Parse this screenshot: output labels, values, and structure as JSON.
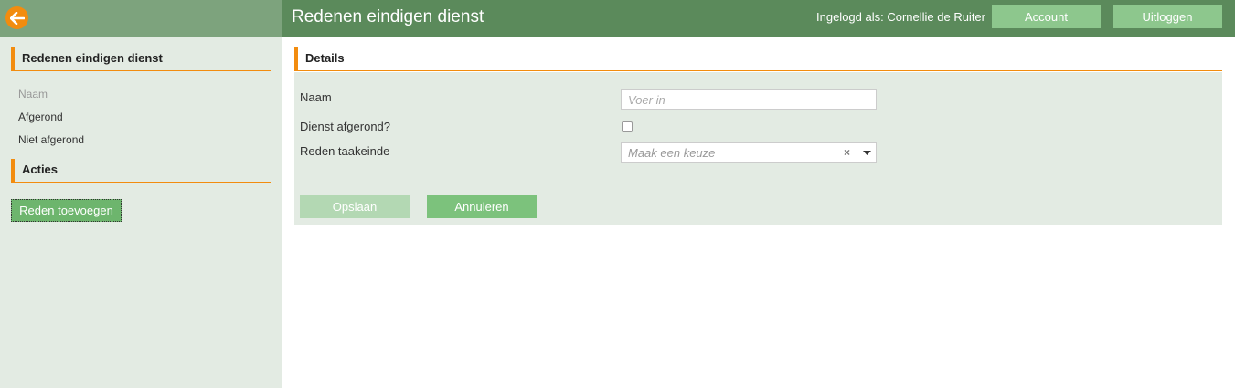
{
  "header": {
    "title": "Redenen eindigen dienst",
    "user_label": "Ingelogd als: Cornellie de Ruiter",
    "account_label": "Account",
    "logout_label": "Uitloggen",
    "back_icon": "arrow-left-icon"
  },
  "sidebar": {
    "section_title": "Redenen eindigen dienst",
    "filters": [
      {
        "label": "Naam"
      },
      {
        "label": "Afgerond"
      },
      {
        "label": "Niet afgerond"
      }
    ],
    "actions_title": "Acties",
    "add_button_label": "Reden toevoegen"
  },
  "details": {
    "title": "Details",
    "name_label": "Naam",
    "name_placeholder": "Voer in",
    "completed_label": "Dienst afgerond?",
    "completed_checked": false,
    "reason_label": "Reden taakeinde",
    "reason_placeholder": "Maak een keuze",
    "save_label": "Opslaan",
    "cancel_label": "Annuleren"
  },
  "colors": {
    "header_green": "#5b8a5b",
    "header_left_green": "#7da37d",
    "accent_orange": "#f28c0f",
    "button_green": "#8dc78d",
    "panel_bg": "#e3ebe3"
  }
}
